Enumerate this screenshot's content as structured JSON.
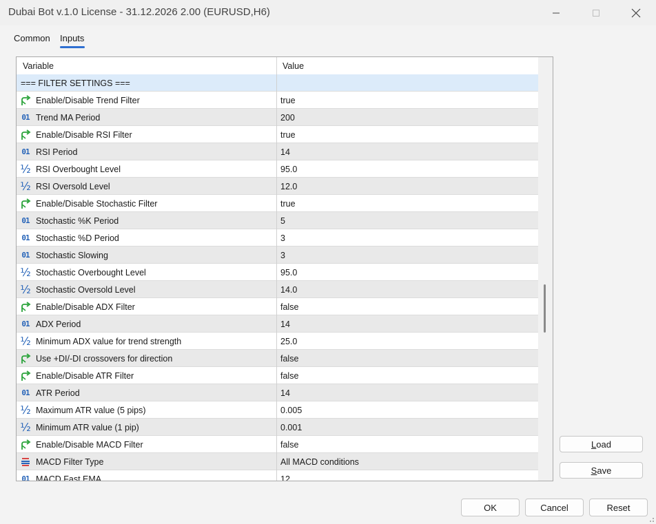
{
  "window": {
    "title": "Dubai Bot v.1.0 License - 31.12.2026 2.00 (EURUSD,H6)"
  },
  "tabs": [
    {
      "label": "Common"
    },
    {
      "label": "Inputs"
    }
  ],
  "grid": {
    "columns": [
      "Variable",
      "Value"
    ],
    "rows": [
      {
        "icon": "none",
        "variable": "=== FILTER SETTINGS ===",
        "value": ""
      },
      {
        "icon": "bool-arrow-icon",
        "variable": "Enable/Disable Trend Filter",
        "value": "true"
      },
      {
        "icon": "int-icon",
        "variable": "Trend MA Period",
        "value": "200"
      },
      {
        "icon": "bool-arrow-icon",
        "variable": "Enable/Disable RSI Filter",
        "value": "true"
      },
      {
        "icon": "int-icon",
        "variable": "RSI Period",
        "value": "14"
      },
      {
        "icon": "double-icon",
        "variable": "RSI Overbought Level",
        "value": "95.0"
      },
      {
        "icon": "double-icon",
        "variable": "RSI Oversold Level",
        "value": "12.0"
      },
      {
        "icon": "bool-arrow-icon",
        "variable": "Enable/Disable Stochastic Filter",
        "value": "true"
      },
      {
        "icon": "int-icon",
        "variable": "Stochastic %K Period",
        "value": "5"
      },
      {
        "icon": "int-icon",
        "variable": "Stochastic %D Period",
        "value": "3"
      },
      {
        "icon": "int-icon",
        "variable": "Stochastic Slowing",
        "value": "3"
      },
      {
        "icon": "double-icon",
        "variable": "Stochastic Overbought Level",
        "value": "95.0"
      },
      {
        "icon": "double-icon",
        "variable": "Stochastic Oversold Level",
        "value": "14.0"
      },
      {
        "icon": "bool-arrow-icon",
        "variable": "Enable/Disable ADX Filter",
        "value": "false"
      },
      {
        "icon": "int-icon",
        "variable": "ADX Period",
        "value": "14"
      },
      {
        "icon": "double-icon",
        "variable": "Minimum ADX value for trend strength",
        "value": "25.0"
      },
      {
        "icon": "bool-arrow-icon",
        "variable": "Use +DI/-DI crossovers for direction",
        "value": "false"
      },
      {
        "icon": "bool-arrow-icon",
        "variable": "Enable/Disable ATR Filter",
        "value": "false"
      },
      {
        "icon": "int-icon",
        "variable": "ATR Period",
        "value": "14"
      },
      {
        "icon": "double-icon",
        "variable": "Maximum ATR value (5 pips)",
        "value": "0.005"
      },
      {
        "icon": "double-icon",
        "variable": "Minimum ATR value (1 pip)",
        "value": "0.001"
      },
      {
        "icon": "bool-arrow-icon",
        "variable": "Enable/Disable MACD Filter",
        "value": "false"
      },
      {
        "icon": "enum-icon",
        "variable": "MACD Filter Type",
        "value": "All MACD conditions"
      },
      {
        "icon": "int-icon",
        "variable": "MACD Fast EMA",
        "value": "12"
      }
    ]
  },
  "buttons": {
    "load": {
      "first": "L",
      "rest": "oad"
    },
    "save": {
      "first": "S",
      "rest": "ave"
    },
    "ok": "OK",
    "cancel": "Cancel",
    "reset": "Reset"
  },
  "icons": {
    "int_text": "01",
    "double_text": "½"
  },
  "colors": {
    "accent": "#2e6fd1",
    "group_row": "#dcebfa",
    "alt_row": "#e9e9e9",
    "bool_icon": "#2aa33a",
    "int_icon": "#2563b8",
    "enum_icon_red": "#d64545"
  }
}
